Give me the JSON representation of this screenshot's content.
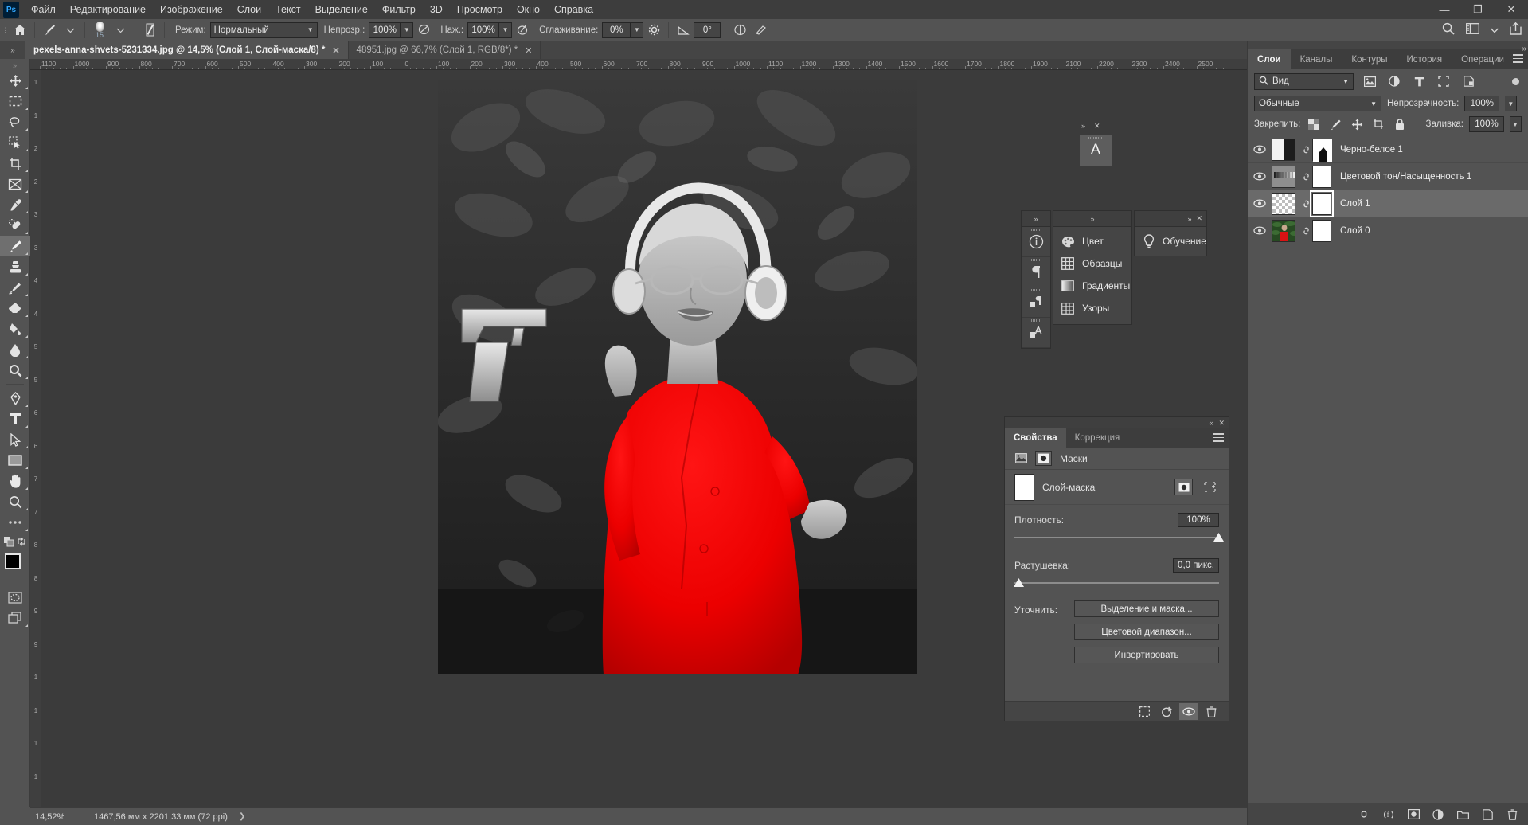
{
  "app": {
    "logo": "Ps"
  },
  "menubar": {
    "items": [
      "Файл",
      "Редактирование",
      "Изображение",
      "Слои",
      "Текст",
      "Выделение",
      "Фильтр",
      "3D",
      "Просмотр",
      "Окно",
      "Справка"
    ]
  },
  "window_controls": {
    "minimize": "—",
    "maximize": "❐",
    "close": "✕"
  },
  "header_right_icons": [
    "search-icon",
    "workspace-icon",
    "chevron-down-icon",
    "share-icon"
  ],
  "options_bar": {
    "home_icon": "home-icon",
    "tool_icon": "brush-tool-icon",
    "brush_size": "15",
    "mode_label": "Режим:",
    "mode_value": "Нормальный",
    "opacity_label": "Непрозр.:",
    "opacity_value": "100%",
    "pressure_label": "Наж.:",
    "pressure_value": "100%",
    "smoothing_label": "Сглаживание:",
    "smoothing_value": "0%",
    "angle_value": "0°"
  },
  "tabs": [
    {
      "title": "pexels-anna-shvets-5231334.jpg @ 14,5% (Слой 1, Слой-маска/8) *",
      "close": "✕",
      "active": true
    },
    {
      "title": "48951.jpg @ 66,7% (Слой 1, RGB/8*) *",
      "close": "✕",
      "active": false
    }
  ],
  "toolbar": {
    "tools": [
      {
        "name": "move-tool",
        "selected": false
      },
      {
        "name": "rectangular-marquee-tool",
        "selected": false
      },
      {
        "name": "lasso-tool",
        "selected": false
      },
      {
        "name": "quick-selection-tool",
        "selected": false
      },
      {
        "name": "crop-tool",
        "selected": false
      },
      {
        "name": "frame-tool",
        "selected": false
      },
      {
        "name": "eyedropper-tool",
        "selected": false
      },
      {
        "name": "healing-brush-tool",
        "selected": false
      },
      {
        "name": "brush-tool",
        "selected": true
      },
      {
        "name": "clone-stamp-tool",
        "selected": false
      },
      {
        "name": "history-brush-tool",
        "selected": false
      },
      {
        "name": "eraser-tool",
        "selected": false
      },
      {
        "name": "gradient-tool",
        "selected": false
      },
      {
        "name": "blur-tool",
        "selected": false
      },
      {
        "name": "dodge-tool",
        "selected": false
      },
      {
        "name": "pen-tool",
        "selected": false
      },
      {
        "name": "type-tool",
        "selected": false
      },
      {
        "name": "path-selection-tool",
        "selected": false
      },
      {
        "name": "rectangle-tool",
        "selected": false
      },
      {
        "name": "hand-tool",
        "selected": false
      },
      {
        "name": "zoom-tool",
        "selected": false
      },
      {
        "name": "edit-toolbar-tool",
        "selected": false
      }
    ],
    "foreground_color": "#000000",
    "background_color": "#ffffff"
  },
  "rulers": {
    "horizontal_ticks": [
      "1100",
      "1000",
      "900",
      "800",
      "700",
      "600",
      "500",
      "400",
      "300",
      "200",
      "100",
      "0",
      "100",
      "200",
      "300",
      "400",
      "500",
      "600",
      "700",
      "800",
      "900",
      "1000",
      "1100",
      "1200",
      "1300",
      "1400",
      "1500",
      "1600",
      "1700",
      "1800",
      "1900",
      "2100",
      "2200",
      "2300",
      "2400",
      "2500"
    ],
    "vertical_ticks": [
      "1",
      "1",
      "2",
      "2",
      "3",
      "3",
      "4",
      "4",
      "5",
      "5",
      "6",
      "6",
      "7",
      "7",
      "8",
      "8",
      "9",
      "9",
      "1",
      "1",
      "1",
      "1",
      "1"
    ]
  },
  "floating_cursor_box": {
    "glyph": "A"
  },
  "float_panels": {
    "left_strip": [
      "info-icon",
      "paragraph-icon",
      "layer-comps-icon",
      "paragraph-styles-icon"
    ],
    "menu_items": [
      {
        "label": "Цвет",
        "icon": "color-palette-icon"
      },
      {
        "label": "Образцы",
        "icon": "swatches-grid-icon"
      },
      {
        "label": "Градиенты",
        "icon": "gradient-icon"
      },
      {
        "label": "Узоры",
        "icon": "patterns-icon"
      }
    ],
    "learn": {
      "label": "Обучение",
      "icon": "lightbulb-icon"
    },
    "collapse_glyph": "»",
    "close_glyph": "✕"
  },
  "properties_panel": {
    "tabs": [
      {
        "label": "Свойства",
        "active": true
      },
      {
        "label": "Коррекция",
        "active": false
      }
    ],
    "collapse_glyph": "«",
    "close_glyph": "✕",
    "section_title": "Маски",
    "section_icons": [
      "pixel-mask-icon",
      "vector-mask-icon"
    ],
    "mask_row": {
      "label": "Слой-маска",
      "actions": [
        "select-mask-icon",
        "add-mask-icon"
      ]
    },
    "density": {
      "label": "Плотность:",
      "value": "100%",
      "percent": 100
    },
    "feather": {
      "label": "Растушевка:",
      "value": "0,0 пикс.",
      "percent": 0
    },
    "refine_label": "Уточнить:",
    "buttons": [
      "Выделение и маска...",
      "Цветовой диапазон...",
      "Инвертировать"
    ],
    "footer_icons": [
      "load-selection-icon",
      "apply-mask-icon",
      "toggle-mask-icon",
      "delete-mask-icon"
    ]
  },
  "layers_panel": {
    "tabs": [
      {
        "label": "Слои",
        "active": true
      },
      {
        "label": "Каналы",
        "active": false
      },
      {
        "label": "Контуры",
        "active": false
      },
      {
        "label": "История",
        "active": false
      },
      {
        "label": "Операции",
        "active": false
      }
    ],
    "filter": {
      "value": "Вид",
      "icon": "search-icon"
    },
    "filter_type_icons": [
      "filter-image-icon",
      "filter-adjustment-icon",
      "filter-type-icon",
      "filter-shape-icon",
      "filter-smart-icon"
    ],
    "blend_mode": "Обычные",
    "opacity_label": "Непрозрачность:",
    "opacity_value": "100%",
    "lock_label": "Закрепить:",
    "lock_icons": [
      "lock-transparent-icon",
      "lock-image-icon",
      "lock-position-icon",
      "lock-artboard-icon",
      "lock-all-icon"
    ],
    "fill_label": "Заливка:",
    "fill_value": "100%",
    "layers": [
      {
        "name": "Черно-белое 1",
        "visible": true,
        "selected": false,
        "type": "adjustment-bw",
        "has_mask": true,
        "mask_selected": false
      },
      {
        "name": "Цветовой тон/Насыщенность 1",
        "visible": true,
        "selected": false,
        "type": "adjustment-huesat",
        "has_mask": true,
        "mask_selected": false
      },
      {
        "name": "Слой 1",
        "visible": true,
        "selected": true,
        "type": "transparent",
        "has_mask": true,
        "mask_selected": true
      },
      {
        "name": "Слой 0",
        "visible": true,
        "selected": false,
        "type": "photo",
        "has_mask": true,
        "mask_selected": false
      }
    ],
    "footer_icons": [
      "link-layers-icon",
      "layer-style-icon",
      "add-mask-icon",
      "adjustment-layer-icon",
      "new-group-icon",
      "new-layer-icon",
      "delete-layer-icon"
    ]
  },
  "status_bar": {
    "zoom": "14,52%",
    "dimensions": "1467,56 мм x 2201,33 мм (72 ppi)",
    "arrow": "❯"
  },
  "colors": {
    "accent_red": "#fa0a0a",
    "panel_bg": "#535353",
    "panel_dark": "#454545",
    "canvas_bg": "#3b3b3b"
  }
}
